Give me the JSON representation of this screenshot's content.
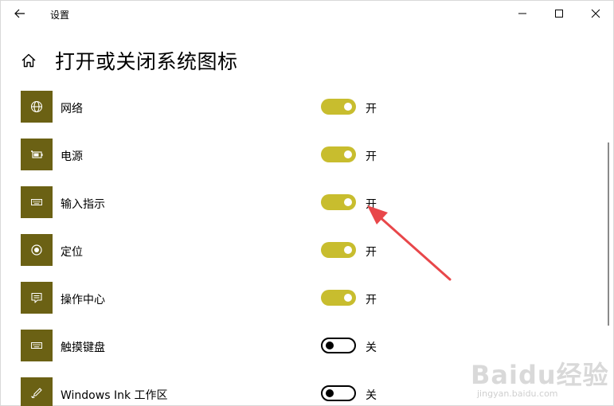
{
  "window": {
    "title": "设置",
    "controls": {
      "minimize": "minimize",
      "maximize": "maximize",
      "close": "close"
    }
  },
  "page": {
    "title": "打开或关闭系统图标"
  },
  "items": [
    {
      "label": "网络",
      "icon": "globe-icon",
      "state": "开",
      "on": true
    },
    {
      "label": "电源",
      "icon": "battery-icon",
      "state": "开",
      "on": true
    },
    {
      "label": "输入指示",
      "icon": "keyboard-icon",
      "state": "开",
      "on": true
    },
    {
      "label": "定位",
      "icon": "location-icon",
      "state": "开",
      "on": true
    },
    {
      "label": "操作中心",
      "icon": "action-center-icon",
      "state": "开",
      "on": true
    },
    {
      "label": "触摸键盘",
      "icon": "keyboard-icon",
      "state": "关",
      "on": false
    },
    {
      "label": "Windows Ink 工作区",
      "icon": "pen-icon",
      "state": "关",
      "on": false
    }
  ],
  "colors": {
    "tile": "#6b6114",
    "toggle_on": "#c8bd2e",
    "arrow": "#e8474a"
  },
  "watermark": {
    "text": "Baidu经验",
    "url": "jingyan.baidu.com"
  }
}
